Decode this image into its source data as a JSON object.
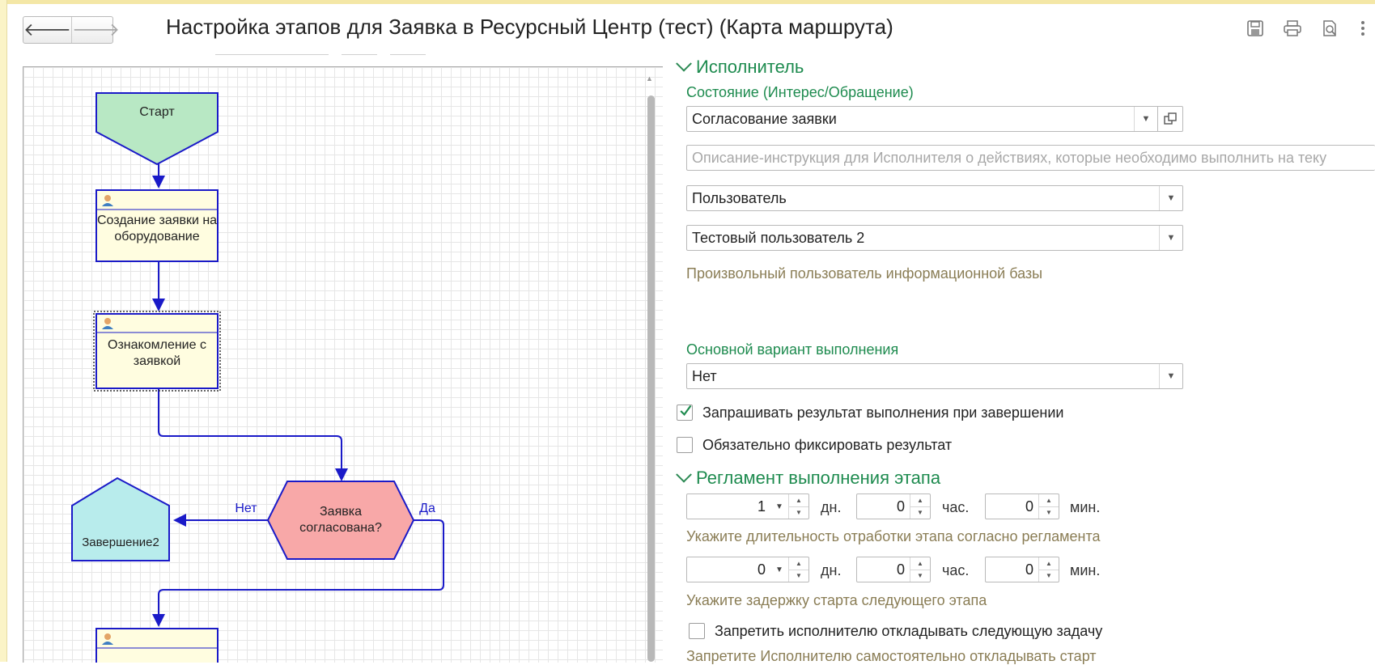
{
  "window": {
    "title": "Настройка этапов для Заявка в Ресурсный Центр (тест) (Карта маршрута)",
    "back_glyph": "🡐",
    "forward_glyph": "🡒"
  },
  "diagram": {
    "start": "Старт",
    "create_request": "Создание заявки на оборудование",
    "review_request": "Ознакомление с заявкой",
    "decision": "Заявка согласована?",
    "end": "Завершение2",
    "no_label": "Нет",
    "yes_label": "Да"
  },
  "executor": {
    "section_title": "Исполнитель",
    "state_label": "Состояние (Интерес/Обращение)",
    "state_value": "Согласование заявки",
    "instruction_placeholder": "Описание-инструкция для Исполнителя о действиях, которые необходимо выполнить на теку",
    "executor_type": "Пользователь",
    "executor_user": "Тестовый пользователь 2",
    "executor_hint": "Произвольный пользователь информационной базы",
    "main_variant_label": "Основной вариант выполнения",
    "main_variant_value": "Нет",
    "ask_result_label": "Запрашивать результат выполнения при завершении",
    "ask_result_checked": true,
    "fix_result_label": "Обязательно фиксировать результат",
    "fix_result_checked": false
  },
  "schedule": {
    "section_title": "Регламент выполнения этапа",
    "duration": {
      "days": "1",
      "hours": "0",
      "minutes": "0"
    },
    "duration_hint": "Укажите длительность отработки этапа согласно регламента",
    "delay": {
      "days": "0",
      "hours": "0",
      "minutes": "0"
    },
    "delay_hint": "Укажите задержку старта следующего этапа",
    "unit_days": "дн.",
    "unit_hours": "час.",
    "unit_minutes": "мин.",
    "forbid_postpone_label": "Запретить исполнителю откладывать следующую задачу",
    "forbid_postpone_checked": false,
    "forbid_postpone_hint": "Запретите Исполнителю самостоятельно откладывать старт"
  },
  "colors": {
    "accent_green": "#1e8b4f",
    "start_fill": "#b8e8c4",
    "task_fill": "#fffde0",
    "decision_fill": "#f8a8a8",
    "end_fill": "#b8ecec",
    "flow_line": "#1a1ac8"
  }
}
